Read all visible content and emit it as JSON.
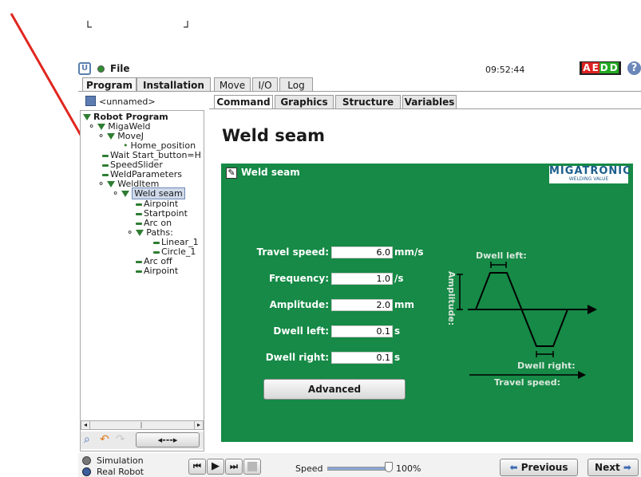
{
  "header": {
    "file_label": "File",
    "time": "09:52:44",
    "badge": "AEDD",
    "help": "?"
  },
  "main_tabs": [
    "Program",
    "Installation",
    "Move",
    "I/O",
    "Log"
  ],
  "program_name": "<unnamed>",
  "sub_tabs": [
    "Command",
    "Graphics",
    "Structure",
    "Variables"
  ],
  "tree": {
    "root": "Robot Program",
    "items": [
      "MigaWeld",
      "MoveJ",
      "Home_position",
      "Wait Start_button=H",
      "SpeedSlider",
      "WeldParameters",
      "WeldItem",
      "Weld seam",
      "Airpoint",
      "Startpoint",
      "Arc on",
      "Paths:",
      "Linear_1",
      "Circle_1",
      "Arc off",
      "Airpoint"
    ]
  },
  "page_title": "Weld seam",
  "panel": {
    "title": "Weld seam",
    "logo": "MIGATRONIC",
    "logo_sub": "WELDING VALUE",
    "fields": [
      {
        "label": "Travel speed:",
        "value": "6.0",
        "unit": "mm/s"
      },
      {
        "label": "Frequency:",
        "value": "1.0",
        "unit": "/s"
      },
      {
        "label": "Amplitude:",
        "value": "2.0",
        "unit": "mm"
      },
      {
        "label": "Dwell left:",
        "value": "0.1",
        "unit": "s"
      },
      {
        "label": "Dwell right:",
        "value": "0.1",
        "unit": "s"
      }
    ],
    "advanced_label": "Advanced",
    "diagram": {
      "dwell_left": "Dwell left:",
      "amplitude": "Amplitude:",
      "dwell_right": "Dwell right:",
      "travel_speed": "Travel speed:"
    }
  },
  "bottom": {
    "simulation": "Simulation",
    "real_robot": "Real Robot",
    "speed_label": "Speed",
    "speed_value": "100%",
    "speed_level": 1.0,
    "previous": "Previous",
    "next": "Next"
  },
  "colors": {
    "panel_green": "#168a46",
    "arrow_red": "#e0261e"
  }
}
